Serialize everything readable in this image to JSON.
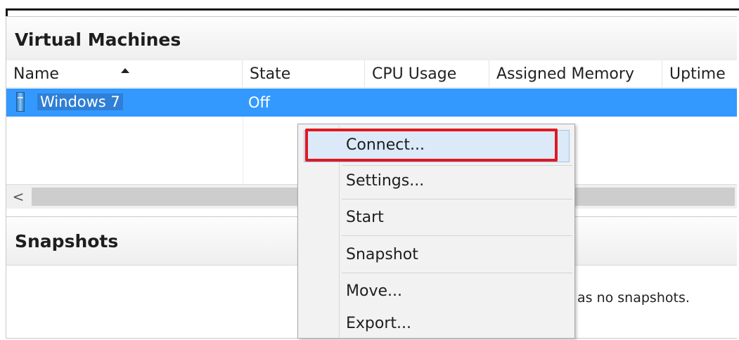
{
  "vm_panel": {
    "title": "Virtual Machines",
    "columns": [
      "Name",
      "State",
      "CPU Usage",
      "Assigned Memory",
      "Uptime"
    ],
    "sort_icon": "sort-ascending-icon",
    "rows": [
      {
        "name": "Windows 7",
        "state": "Off",
        "icon": "virtual-machine-icon"
      }
    ],
    "scroll_left_glyph": "<"
  },
  "snapshots_panel": {
    "title": "Snapshots",
    "message_fragment": "as no snapshots."
  },
  "context_menu": {
    "items": [
      {
        "label": "Connect...",
        "highlighted": true
      },
      {
        "label": "Settings..."
      },
      {
        "label": "Start"
      },
      {
        "label": "Snapshot"
      },
      {
        "label": "Move..."
      },
      {
        "label": "Export..."
      }
    ]
  },
  "colors": {
    "selection": "#3399ff",
    "menu_hover": "#dbe9f8",
    "annotation_box": "#e0191f"
  }
}
